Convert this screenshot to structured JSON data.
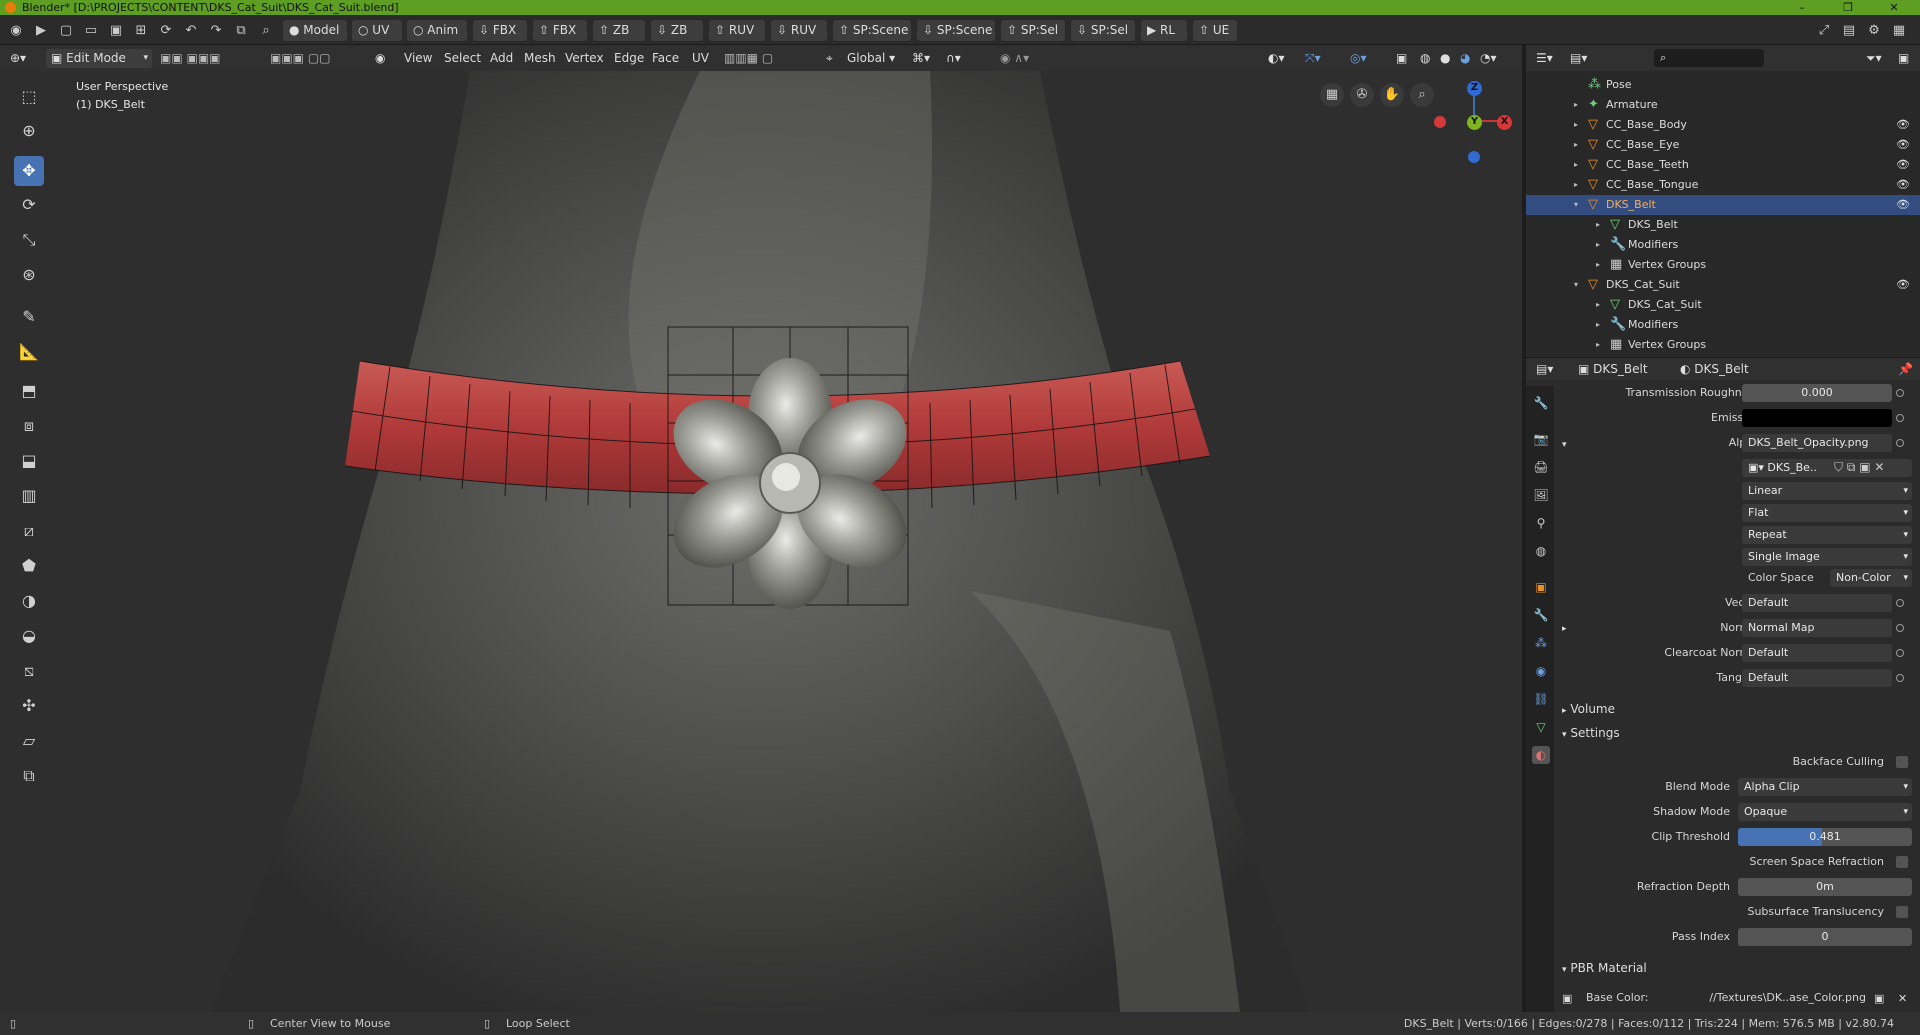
{
  "title_bar": {
    "text": "Blender* [D:\\PROJECTS\\CONTENT\\DKS_Cat_Suit\\DKS_Cat_Suit.blend]",
    "minimize": "–",
    "maximize": "❐",
    "close": "✕"
  },
  "top_toolbar": {
    "buttons": [
      "Model",
      "UV",
      "Anim",
      "FBX",
      "FBX",
      "ZB",
      "ZB",
      "RUV",
      "RUV",
      "SP:Scene",
      "SP:Scene",
      "SP:Sel",
      "SP:Sel",
      "RL",
      "UE"
    ]
  },
  "viewport_header": {
    "mode": "Edit Mode",
    "menus": [
      "View",
      "Select",
      "Add",
      "Mesh",
      "Vertex",
      "Edge",
      "Face",
      "UV"
    ],
    "transform_orientation": "Global"
  },
  "viewport": {
    "perspective_label": "User Perspective",
    "object_label": "(1) DKS_Belt",
    "gizmo": {
      "z": "Z",
      "y": "Y",
      "x": "X"
    }
  },
  "outliner": {
    "items": [
      {
        "label": "Pose",
        "icon": "pose-icon",
        "indent": 0
      },
      {
        "label": "Armature",
        "icon": "armature-icon",
        "indent": 0,
        "expand": "▸"
      },
      {
        "label": "CC_Base_Body",
        "icon": "mesh-object-icon",
        "indent": 0,
        "expand": "▸",
        "eye": "👁"
      },
      {
        "label": "CC_Base_Eye",
        "icon": "mesh-object-icon",
        "indent": 0,
        "expand": "▸",
        "eye": "👁"
      },
      {
        "label": "CC_Base_Teeth",
        "icon": "mesh-object-icon",
        "indent": 0,
        "expand": "▸",
        "eye": "👁"
      },
      {
        "label": "CC_Base_Tongue",
        "icon": "mesh-object-icon",
        "indent": 0,
        "expand": "▸",
        "eye": "👁"
      },
      {
        "label": "DKS_Belt",
        "icon": "mesh-object-icon",
        "indent": 0,
        "expand": "▾",
        "eye": "👁",
        "selected": true
      },
      {
        "label": "DKS_Belt",
        "icon": "mesh-data-icon",
        "indent": 1,
        "expand": "▸"
      },
      {
        "label": "Modifiers",
        "icon": "wrench-icon",
        "indent": 1,
        "expand": "▸"
      },
      {
        "label": "Vertex Groups",
        "icon": "vertex-groups-icon",
        "indent": 1,
        "expand": "▸"
      },
      {
        "label": "DKS_Cat_Suit",
        "icon": "mesh-object-icon",
        "indent": 0,
        "expand": "▾",
        "eye": "👁"
      },
      {
        "label": "DKS_Cat_Suit",
        "icon": "mesh-data-icon",
        "indent": 1,
        "expand": "▸"
      },
      {
        "label": "Modifiers",
        "icon": "wrench-icon",
        "indent": 1,
        "expand": "▸"
      },
      {
        "label": "Vertex Groups",
        "icon": "vertex-groups-icon",
        "indent": 1,
        "expand": "▸"
      }
    ]
  },
  "properties": {
    "header": {
      "object": "DKS_Belt",
      "material": "DKS_Belt"
    },
    "transmission_roughness": {
      "label": "Transmission Roughness",
      "value": "0.000"
    },
    "emission": {
      "label": "Emission"
    },
    "alpha": {
      "label": "Alpha",
      "value": "DKS_Belt_Opacity.png"
    },
    "image_block": {
      "name": "DKS_Be.."
    },
    "interpolation": "Linear",
    "projection": "Flat",
    "extension": "Repeat",
    "source": "Single Image",
    "color_space": {
      "label": "Color Space",
      "value": "Non-Color"
    },
    "vector": {
      "label": "Vector",
      "value": "Default"
    },
    "normal": {
      "label": "Normal",
      "value": "Normal Map"
    },
    "clearcoat_normal": {
      "label": "Clearcoat Normal",
      "value": "Default"
    },
    "tangent": {
      "label": "Tangent",
      "value": "Default"
    },
    "panels": {
      "volume": "Volume",
      "settings": "Settings",
      "pbr": "PBR Material"
    },
    "settings": {
      "backface_culling": "Backface Culling",
      "blend_mode": {
        "label": "Blend Mode",
        "value": "Alpha Clip"
      },
      "shadow_mode": {
        "label": "Shadow Mode",
        "value": "Opaque"
      },
      "clip_threshold": {
        "label": "Clip Threshold",
        "value": "0.481",
        "fraction": 0.481
      },
      "ssr": "Screen Space Refraction",
      "refraction_depth": {
        "label": "Refraction Depth",
        "value": "0m"
      },
      "subsurface_translucency": "Subsurface Translucency",
      "pass_index": {
        "label": "Pass Index",
        "value": "0"
      }
    },
    "pbr": {
      "base_color_label": "Base Color:",
      "base_color_value": "//Textures\\DK..ase_Color.png"
    }
  },
  "status_bar": {
    "left1": "Center View to Mouse",
    "left2": "Loop Select",
    "right": "DKS_Belt | Verts:0/166 | Edges:0/278 | Faces:0/112 | Tris:224 | Mem: 576.5 MB | v2.80.74"
  },
  "colors": {
    "accent": "#4772b3",
    "title_bar": "#5e9e22",
    "selection": "#334d80",
    "belt": "#b5403f"
  }
}
